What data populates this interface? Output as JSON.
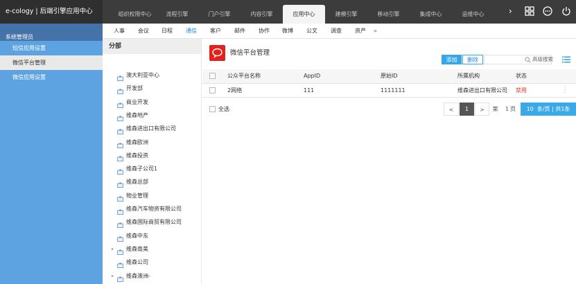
{
  "app": {
    "title": "e-cology | 后端引擎应用中心"
  },
  "main_tabs": [
    "组织权限中心",
    "流程引擎",
    "门户引擎",
    "内容引擎",
    "应用中心",
    "建模引擎",
    "移动引擎",
    "集成中心",
    "运维中心"
  ],
  "main_tab_active": "应用中心",
  "sidebar": {
    "header": "系统管理员",
    "items": [
      "短信应用设置",
      "微信平台管理",
      "微信应用设置"
    ],
    "active": "微信平台管理"
  },
  "subnav": {
    "items": [
      "人事",
      "会议",
      "日程",
      "通信",
      "客户",
      "邮件",
      "协作",
      "微博",
      "公文",
      "调查",
      "资产"
    ],
    "active": "通信",
    "more": "»"
  },
  "tree": {
    "title": "分部",
    "nodes": [
      {
        "label": "澳大利亚中心",
        "expandable": false
      },
      {
        "label": "开发部",
        "expandable": false
      },
      {
        "label": "商业开发",
        "expandable": false
      },
      {
        "label": "维森地产",
        "expandable": false
      },
      {
        "label": "维森进出口有限公司",
        "expandable": false
      },
      {
        "label": "维森欧洲",
        "expandable": false
      },
      {
        "label": "维森投资",
        "expandable": false
      },
      {
        "label": "维森子公司1",
        "expandable": false
      },
      {
        "label": "维森总部",
        "expandable": false
      },
      {
        "label": "物业管理",
        "expandable": false
      },
      {
        "label": "维森汽车物资有限公司",
        "expandable": false
      },
      {
        "label": "维森国际商贸有限公司",
        "expandable": false
      },
      {
        "label": "维森中东",
        "expandable": false
      },
      {
        "label": "维森南美",
        "expandable": true
      },
      {
        "label": "维森公司",
        "expandable": false
      },
      {
        "label": "维森澳洲-",
        "expandable": true
      }
    ]
  },
  "content": {
    "title": "微信平台管理",
    "add_label": "添加",
    "delete_label": "删除",
    "search_placeholder": "",
    "advanced_search": "高级搜索",
    "columns": [
      "公众平台名称",
      "AppID",
      "原始ID",
      "所属机构",
      "状态"
    ],
    "rows": [
      {
        "name": "2网络",
        "appid": "111",
        "original_id": "1111111",
        "org": "维森进出口有限公司",
        "status": "禁用"
      }
    ],
    "select_all": "全选"
  },
  "pager": {
    "prev": "<",
    "current": "1",
    "next": ">",
    "goto_label": "第",
    "page_input": "1",
    "page_suffix": "页",
    "page_size": "10",
    "summary": "条/页 | 共1条"
  },
  "colors": {
    "topbar": "#3c3c3c",
    "sidebar": "#5ea3e1",
    "accent": "#35a6ea",
    "danger": "#e53935",
    "logo": "#e5211d"
  },
  "icons": [
    "grid-icon",
    "more-icon",
    "power-icon",
    "search-icon",
    "list-view-icon",
    "wechat-logo-icon",
    "building-icon",
    "chevron-right-icon",
    "chevron-left-icon"
  ]
}
